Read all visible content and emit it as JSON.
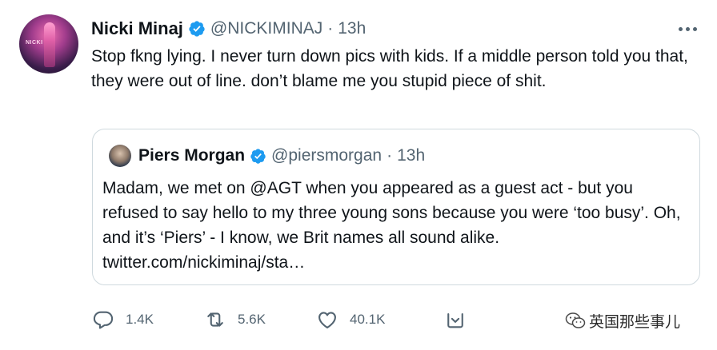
{
  "tweet": {
    "author_name": "Nicki Minaj",
    "handle": "@NICKIMINAJ",
    "separator": "·",
    "time": "13h",
    "avatar_text": "NICKI",
    "text": "Stop fkng lying. I never turn down pics with kids. If a middle person told you that, they were out of line.  don’t blame me you stupid piece of shit."
  },
  "quoted_tweet": {
    "author_name": "Piers Morgan",
    "handle": "@piersmorgan",
    "separator": "·",
    "time": "13h",
    "text": "Madam, we met on @AGT when you appeared as a guest act - but you refused to say hello to my three young sons because you were ‘too busy’. Oh, and it’s ‘Piers’ - I know, we Brit names all sound alike. twitter.com/nickiminaj/sta…"
  },
  "actions": {
    "reply_count": "1.4K",
    "retweet_count": "5.6K",
    "like_count": "40.1K"
  },
  "icons": {
    "reply": "comment-icon",
    "retweet": "retweet-icon",
    "like": "heart-icon",
    "share": "share-icon",
    "more": "more-options-icon",
    "verified": "verified-badge-icon"
  },
  "colors": {
    "verified_blue": "#1d9bf0",
    "secondary_text": "#536471",
    "primary_text": "#0f1419",
    "border": "#cfd9de"
  },
  "watermark": {
    "text": "英国那些事儿"
  }
}
